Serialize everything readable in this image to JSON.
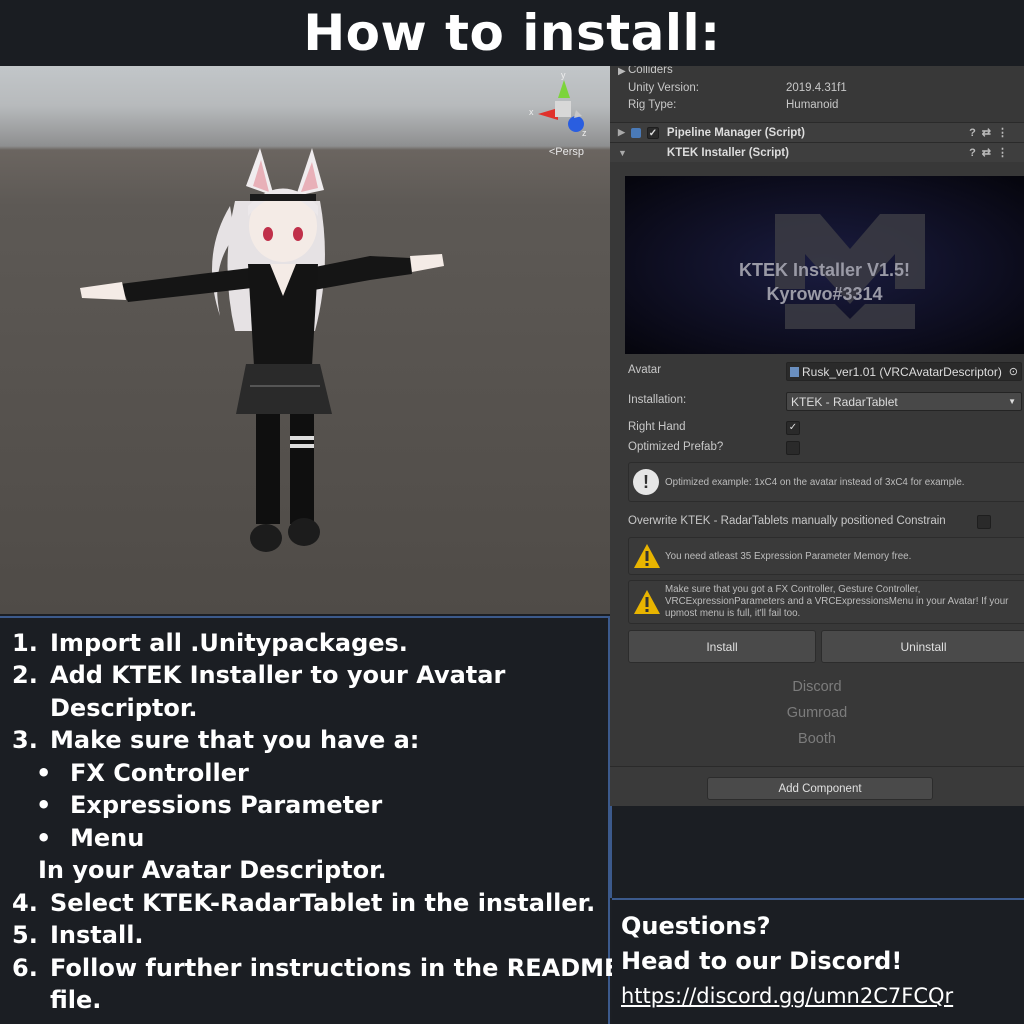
{
  "title": "How to install:",
  "scene": {
    "view_mode": "<Persp",
    "gizmo_axes": {
      "y": "y",
      "x": "x",
      "z": "z"
    }
  },
  "inspector": {
    "colliders": "Colliders",
    "unity_version_label": "Unity Version:",
    "unity_version_value": "2019.4.31f1",
    "rig_type_label": "Rig Type:",
    "rig_type_value": "Humanoid",
    "pipeline_component": "Pipeline Manager (Script)",
    "ktek_component": "KTEK Installer (Script)",
    "banner": {
      "line1": "KTEK Installer V1.5!",
      "line2": "Kyrowo#3314"
    },
    "avatar_label": "Avatar",
    "avatar_value": "Rusk_ver1.01 (VRCAvatarDescriptor)",
    "installation_label": "Installation:",
    "installation_value": "KTEK - RadarTablet",
    "right_hand_label": "Right Hand",
    "right_hand_checked": true,
    "optimized_prefab_label": "Optimized Prefab?",
    "optimized_prefab_checked": false,
    "info_optimized": "Optimized example: 1xC4 on the avatar instead of 3xC4 for example.",
    "overwrite_label": "Overwrite KTEK - RadarTablets manually positioned Constrain",
    "overwrite_checked": false,
    "warning_memory": "You need atleast 35 Expression Parameter Memory free.",
    "warning_controllers": "Make sure that you got a FX Controller, Gesture Controller, VRCExpressionParameters and a VRCExpressionsMenu in your Avatar! If your upmost menu is full, it'll fail too.",
    "install_button": "Install",
    "uninstall_button": "Uninstall",
    "links": [
      "Discord",
      "Gumroad",
      "Booth"
    ],
    "add_component_button": "Add Component"
  },
  "instructions": {
    "steps": [
      {
        "num": "1.",
        "text": "Import all .Unitypackages."
      },
      {
        "num": "2.",
        "text": "Add KTEK Installer to your Avatar"
      },
      {
        "num": "",
        "text": "Descriptor."
      },
      {
        "num": "3.",
        "text": "Make sure that you have a:"
      }
    ],
    "bullets": [
      "FX Controller",
      "Expressions Parameter",
      "Menu"
    ],
    "bullet_glyph": "•",
    "after_bullets": "In your Avatar Descriptor.",
    "steps_after": [
      {
        "num": "4.",
        "text": "Select KTEK-RadarTablet in the installer."
      },
      {
        "num": "5.",
        "text": "Install."
      },
      {
        "num": "6.",
        "text": "Follow further instructions in the README"
      },
      {
        "num": "",
        "text": "file."
      }
    ]
  },
  "questions": {
    "line1": "Questions?",
    "line2": "Head to our Discord!",
    "link": "https://discord.gg/umn2C7FCQr"
  },
  "colors": {
    "accent_border": "#3c5a8c",
    "warning": "#e8b400",
    "panel": "#383838"
  }
}
